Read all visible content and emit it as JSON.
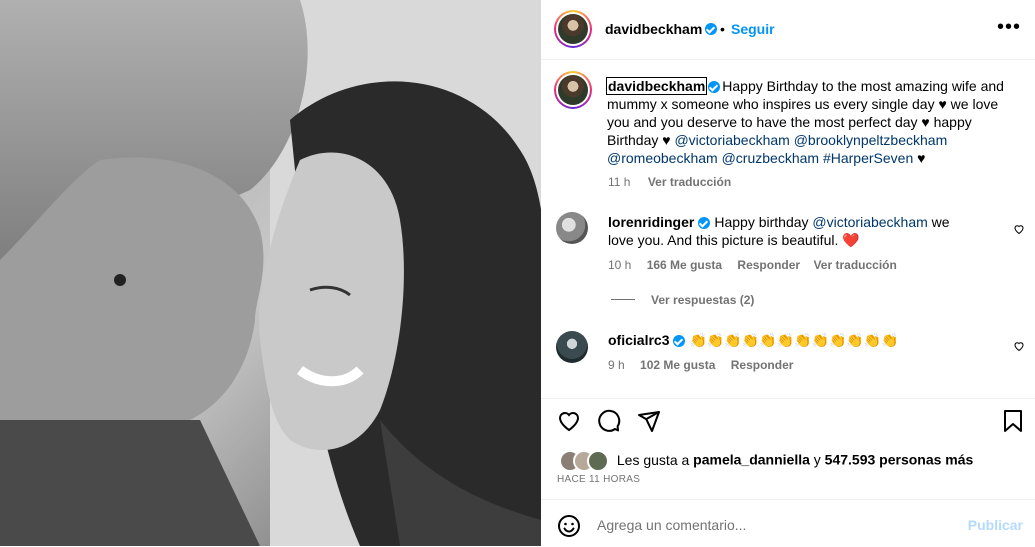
{
  "post": {
    "username": "davidbeckham",
    "follow_label": "Seguir",
    "more_label": "•••",
    "photo_alt": "black and white photo of a couple kissing"
  },
  "caption": {
    "username": "davidbeckham",
    "text1": "Happy Birthday to the most amazing wife and mummy x someone who inspires us every single day ♥ we love you and you deserve to have the most perfect day ♥ happy Birthday ♥ ",
    "mention1": "@victoriabeckham",
    "mention2": "@brooklynpeltzbeckham",
    "mention3": "@romeobeckham",
    "mention4": "@cruzbeckham",
    "hashtag": "#HarperSeven",
    "end": " ♥",
    "time": "11 h",
    "translate": "Ver traducción"
  },
  "comments": [
    {
      "username": "lorenridinger",
      "text_before": "Happy birthday ",
      "mention": "@victoriabeckham",
      "text_after": " we love you. And this picture is beautiful. ",
      "emoji": "❤️",
      "time": "10 h",
      "likes": "166 Me gusta",
      "reply": "Responder",
      "translate": "Ver traducción",
      "replies": "Ver respuestas (2)"
    },
    {
      "username": "oficialrc3",
      "text": "👏👏👏👏👏👏👏👏👏👏👏👏",
      "time": "9 h",
      "likes": "102 Me gusta",
      "reply": "Responder"
    }
  ],
  "likes": {
    "prefix": "Les gusta a ",
    "user": "pamela_danniella",
    "mid": " y ",
    "count": "547.593 personas más"
  },
  "ago": "HACE 11 HORAS",
  "comment_box": {
    "placeholder": "Agrega un comentario...",
    "publish": "Publicar"
  },
  "icons": [
    "heart-icon",
    "comment-icon",
    "share-icon",
    "bookmark-icon",
    "emoji-icon",
    "more-options-icon"
  ]
}
